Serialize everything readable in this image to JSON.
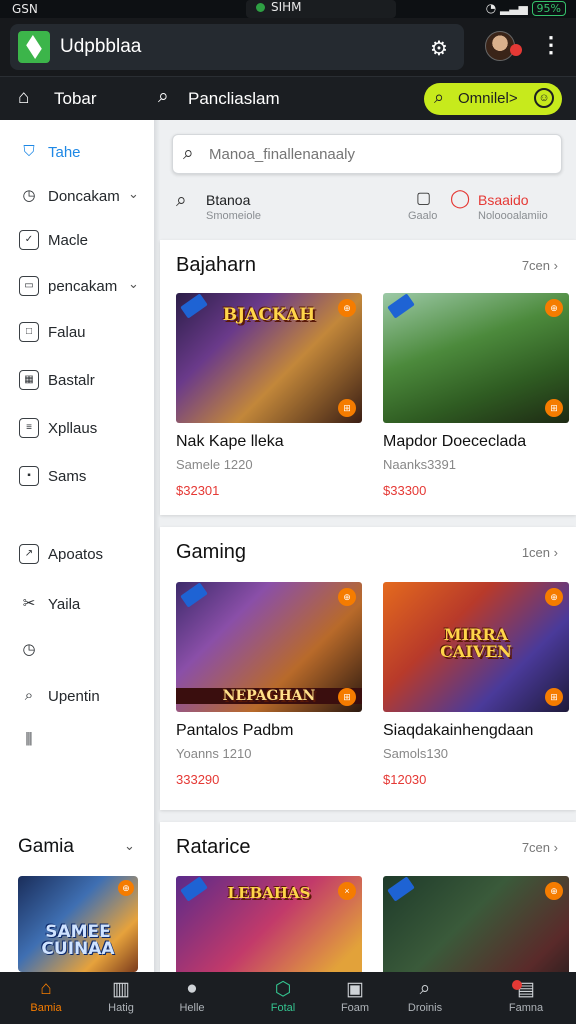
{
  "status_bar": {
    "left": "GSN",
    "carrier": "SIHM",
    "battery": "95%"
  },
  "app": {
    "title": "Udpbblaa",
    "icons": {
      "settings": "settings-icon",
      "more": "more-vertical-icon"
    }
  },
  "nav": {
    "home_label": "Tobar",
    "search_label": "Pancliaslam",
    "download_label": "Omnilel>"
  },
  "sidebar": {
    "items": [
      {
        "label": "Tahe",
        "icon": "tag-icon",
        "active": true,
        "chevron": false
      },
      {
        "label": "Doncakam",
        "icon": "clock-icon",
        "active": false,
        "chevron": true
      },
      {
        "label": "Macle",
        "icon": "check-icon",
        "active": false,
        "chevron": false
      },
      {
        "label": "pencakam",
        "icon": "window-icon",
        "active": false,
        "chevron": true
      },
      {
        "label": "Falau",
        "icon": "square-icon",
        "active": false,
        "chevron": false
      },
      {
        "label": "Bastalr",
        "icon": "grid-icon",
        "active": false,
        "chevron": false
      },
      {
        "label": "Xpllaus",
        "icon": "list-icon",
        "active": false,
        "chevron": false
      },
      {
        "label": "Sams",
        "icon": "box-icon",
        "active": false,
        "chevron": false
      },
      {
        "label": "Apoatos",
        "icon": "chart-icon",
        "active": false,
        "chevron": false
      },
      {
        "label": "Yaila",
        "icon": "tools-icon",
        "active": false,
        "chevron": false
      },
      {
        "label": "",
        "icon": "clock-icon",
        "active": false,
        "chevron": false
      },
      {
        "label": "Upentin",
        "icon": "search-icon",
        "active": false,
        "chevron": false
      },
      {
        "label": "",
        "icon": "equalizer-icon",
        "active": false,
        "chevron": false
      }
    ],
    "section_title": "Gamia",
    "thumb_text": "SAMEE CUINAA"
  },
  "search": {
    "placeholder": "Manoa_finallenanaaly"
  },
  "filters": {
    "left_title": "Btanoa",
    "left_sub": "Smomeiole",
    "mid_label": "Gaalo",
    "right_title": "Bsaaido",
    "right_sub": "Noloooalamiio"
  },
  "sections": [
    {
      "title": "Bajaharn",
      "more": "7cen",
      "games": [
        {
          "name": "Nak Kape lleka",
          "sub": "Samele 1220",
          "price": "$32301",
          "art": "BJACKAH"
        },
        {
          "name": "Mapdor Doececlada",
          "sub": "Naanks3391",
          "price": "$33300",
          "art": ""
        }
      ]
    },
    {
      "title": "Gaming",
      "more": "1cen",
      "games": [
        {
          "name": "Pantalos Padbm",
          "sub": "Yoanns 1210",
          "price": "333290",
          "art": "NEPAGHAN"
        },
        {
          "name": "Siaqdakainhengdaan",
          "sub": "Samols130",
          "price": "$12030",
          "art": "MIRRA CAIVEN"
        }
      ]
    },
    {
      "title": "Ratarice",
      "more": "7cen",
      "games": [
        {
          "name": "",
          "sub": "",
          "price": "",
          "art": "LEBAHAS"
        },
        {
          "name": "",
          "sub": "",
          "price": "",
          "art": ""
        }
      ]
    }
  ],
  "bottom_nav": [
    {
      "label": "Bamia",
      "icon": "home-icon",
      "state": "active"
    },
    {
      "label": "Hatig",
      "icon": "book-icon",
      "state": ""
    },
    {
      "label": "Helle",
      "icon": "chat-icon",
      "state": ""
    },
    {
      "label": "Fotal",
      "icon": "compass-icon",
      "state": "highlight"
    },
    {
      "label": "Foam",
      "icon": "layout-icon",
      "state": ""
    },
    {
      "label": "Droinis",
      "icon": "search-icon",
      "state": ""
    },
    {
      "label": "Famna",
      "icon": "controller-icon",
      "state": ""
    }
  ],
  "colors": {
    "accent_lime": "#c7ea1c",
    "accent_orange": "#f57c00",
    "price_red": "#e53935",
    "active_blue": "#1e88e5",
    "highlight_green": "#34c38f"
  }
}
